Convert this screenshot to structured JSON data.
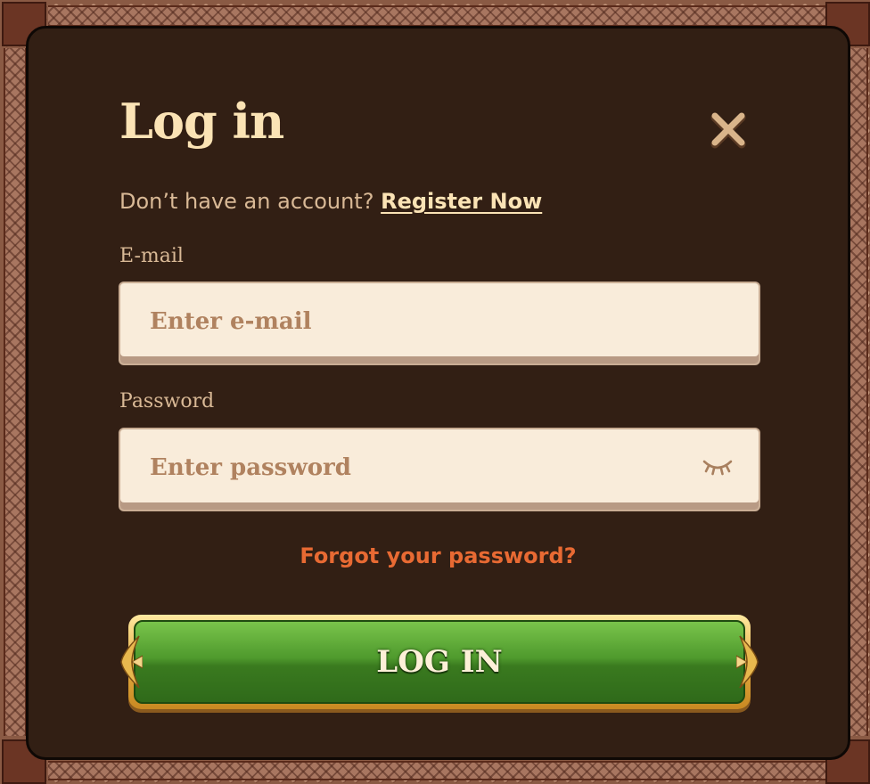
{
  "modal": {
    "title": "Log in",
    "register_prompt": "Don’t have an account?",
    "register_link": "Register Now"
  },
  "form": {
    "email_label": "E-mail",
    "email_placeholder": "Enter e-mail",
    "email_value": "",
    "password_label": "Password",
    "password_placeholder": "Enter password",
    "password_value": "",
    "forgot_link": "Forgot your password?",
    "submit_label": "LOG IN"
  },
  "icons": {
    "close": "close-icon",
    "password_toggle": "eye-closed-icon"
  },
  "colors": {
    "modal_bg": "#321f14",
    "title": "#fbe3b5",
    "muted_text": "#d9b996",
    "link_accent": "#e86a33",
    "input_bg": "#f9ecda",
    "button_green": "#4f9a2d",
    "button_gold": "#e2a93e"
  }
}
